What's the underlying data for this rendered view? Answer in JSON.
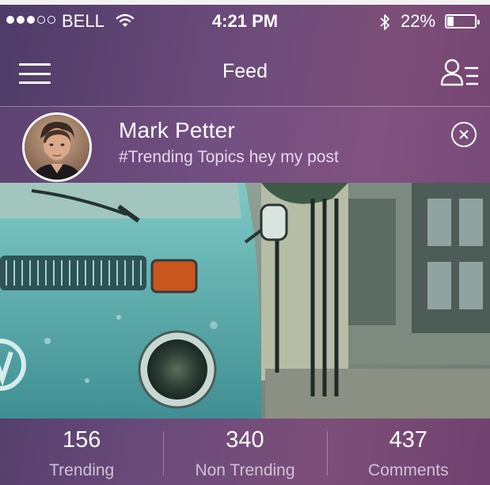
{
  "status_bar": {
    "carrier": "BELL",
    "time": "4:21 PM",
    "battery": "22%",
    "battery_level": 0.22,
    "signal_bars_filled": 3,
    "signal_bars_total": 5,
    "icons": [
      "wifi-icon",
      "bluetooth-icon",
      "battery-icon"
    ]
  },
  "navbar": {
    "title": "Feed",
    "icons": [
      "hamburger-menu-icon",
      "user-list-icon"
    ]
  },
  "post": {
    "author": "Mark Petter",
    "caption": "#Trending Topics hey my post",
    "icons": [
      "avatar",
      "close-icon"
    ],
    "image": "photo of a vintage turquoise VW van parked on an old street"
  },
  "stats": [
    {
      "value": "156",
      "label": "Trending"
    },
    {
      "value": "340",
      "label": "Non Trending"
    },
    {
      "value": "437",
      "label": "Comments"
    }
  ],
  "colors": {
    "background_start": "#4e3b67",
    "background_end": "#70406e",
    "text": "#ffffff",
    "muted_text": "#cfc2d8"
  }
}
